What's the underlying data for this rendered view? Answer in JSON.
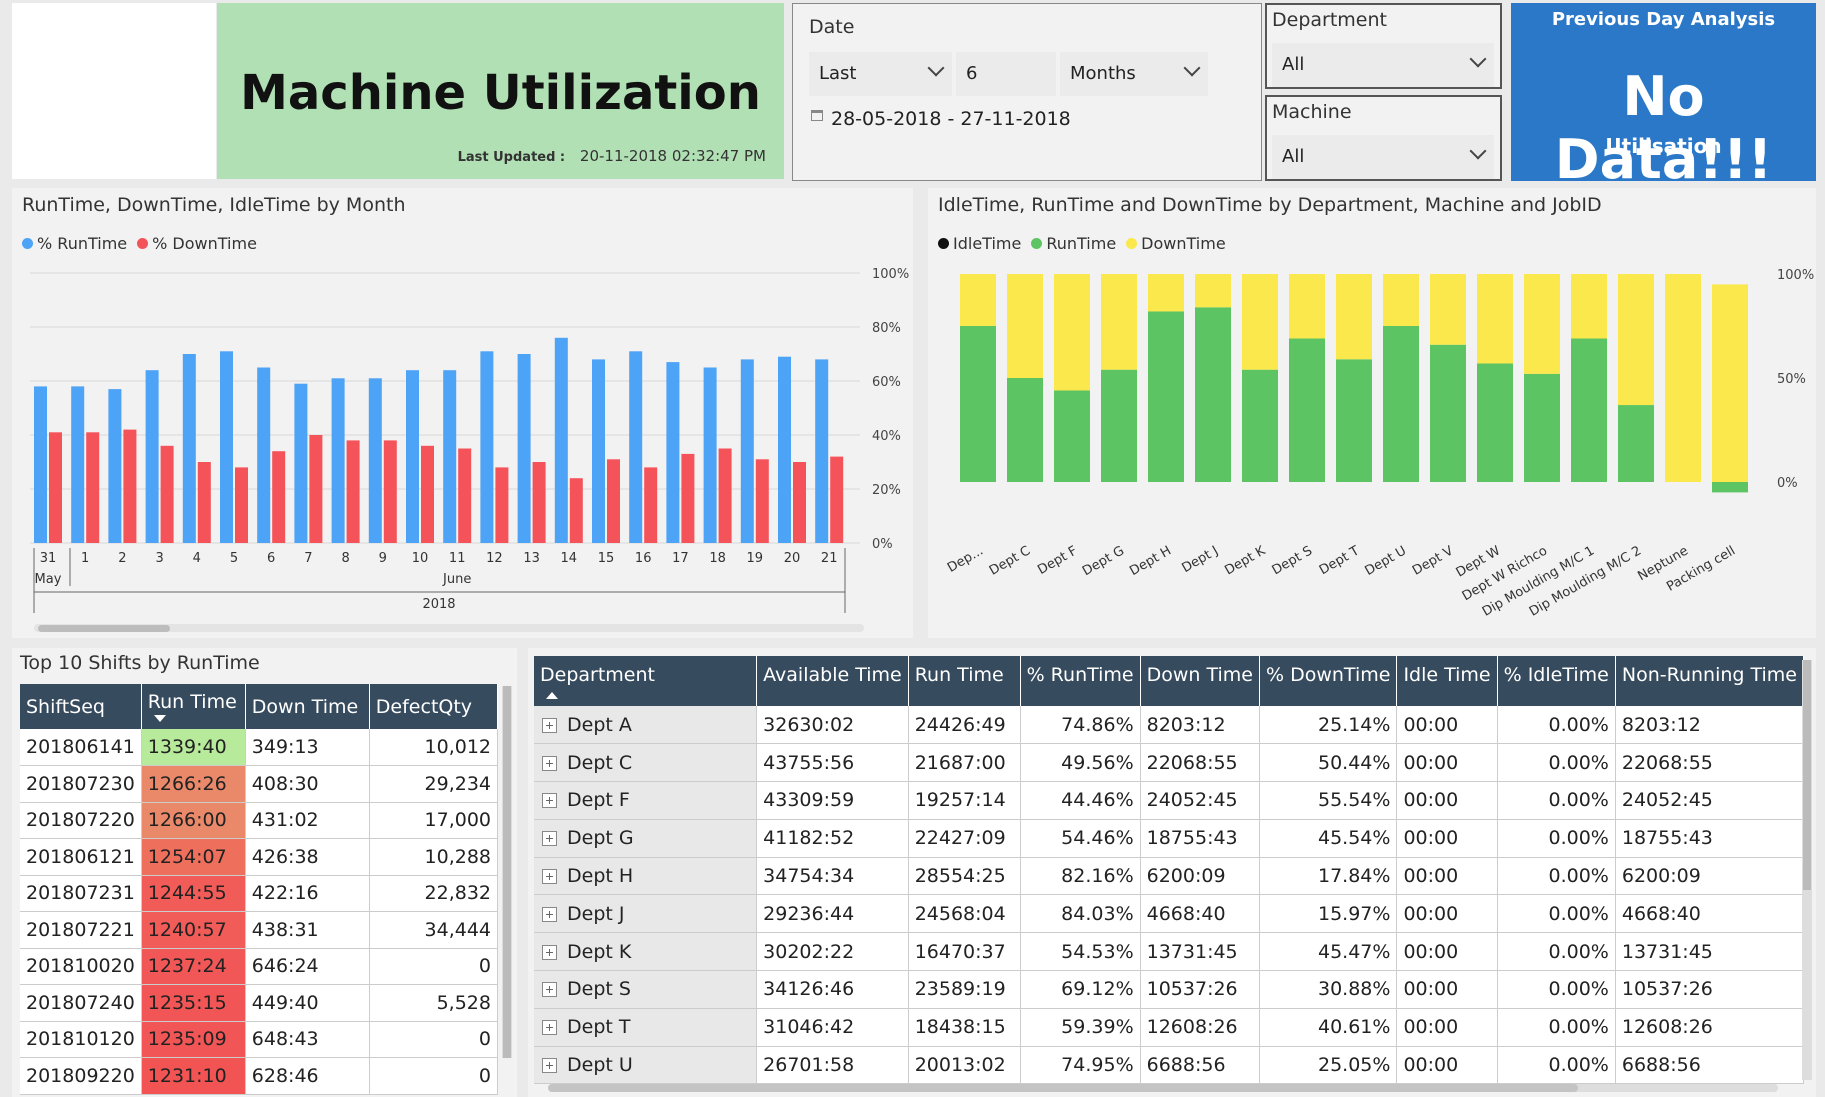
{
  "header": {
    "title": "Machine Utilization",
    "last_updated_label": "Last Updated :",
    "last_updated_value": "20-11-2018 02:32:47 PM"
  },
  "date_slicer": {
    "title": "Date",
    "mode": "Last",
    "count": "6",
    "unit": "Months",
    "range": "28-05-2018 - 27-11-2018"
  },
  "department_slicer": {
    "title": "Department",
    "value": "All"
  },
  "machine_slicer": {
    "title": "Machine",
    "value": "All"
  },
  "previous_day": {
    "title": "Previous Day Analysis",
    "value": "No Data!!!",
    "subtitle": "Utilisation"
  },
  "colors": {
    "runtime_blue": "#4da3f5",
    "downtime_red": "#f5535a",
    "runtime_green": "#5cc463",
    "downtime_yellow": "#fae84c",
    "idle_black": "#111111",
    "header_navy": "#374b5e",
    "accent_blue": "#2a78c7"
  },
  "chart_data": [
    {
      "type": "bar",
      "title": "RunTime, DownTime, IdleTime by Month",
      "categories": [
        "31",
        "1",
        "2",
        "3",
        "4",
        "5",
        "6",
        "7",
        "8",
        "9",
        "10",
        "11",
        "12",
        "13",
        "14",
        "15",
        "16",
        "17",
        "18",
        "19",
        "20",
        "21"
      ],
      "group_labels": [
        {
          "label": "May",
          "from": 0,
          "to": 0
        },
        {
          "label": "June",
          "from": 1,
          "to": 21
        }
      ],
      "year_label": "2018",
      "series": [
        {
          "name": "% RunTime",
          "color": "#4da3f5",
          "values": [
            58,
            58,
            57,
            64,
            70,
            71,
            65,
            59,
            61,
            61,
            64,
            64,
            71,
            70,
            76,
            68,
            71,
            67,
            65,
            68,
            69,
            68
          ]
        },
        {
          "name": "% DownTime",
          "color": "#f5535a",
          "values": [
            41,
            41,
            42,
            36,
            30,
            28,
            34,
            40,
            38,
            38,
            36,
            35,
            28,
            30,
            24,
            31,
            28,
            33,
            35,
            31,
            30,
            32
          ]
        }
      ],
      "y_ticks": [
        "0%",
        "20%",
        "40%",
        "60%",
        "80%",
        "100%"
      ],
      "ylim": [
        0,
        100
      ]
    },
    {
      "type": "bar",
      "stacked": true,
      "title": "IdleTime, RunTime and DownTime by Department, Machine and JobID",
      "categories": [
        "Dep...",
        "Dept C",
        "Dept F",
        "Dept G",
        "Dept H",
        "Dept J",
        "Dept K",
        "Dept S",
        "Dept T",
        "Dept U",
        "Dept V",
        "Dept W",
        "Dept W Richco",
        "Dip Moulding M/C 1",
        "Dip Moulding M/C 2",
        "Neptune",
        "Packing cell"
      ],
      "series": [
        {
          "name": "IdleTime",
          "color": "#111111",
          "values": [
            0,
            0,
            0,
            0,
            0,
            0,
            0,
            0,
            0,
            0,
            0,
            0,
            0,
            0,
            0,
            0,
            0
          ]
        },
        {
          "name": "RunTime",
          "color": "#5cc463",
          "values": [
            75,
            50,
            44,
            54,
            82,
            84,
            54,
            69,
            59,
            75,
            66,
            57,
            52,
            69,
            37,
            0,
            -5
          ]
        },
        {
          "name": "DownTime",
          "color": "#fae84c",
          "values": [
            25,
            50,
            56,
            46,
            18,
            16,
            46,
            31,
            41,
            25,
            34,
            43,
            48,
            31,
            63,
            100,
            95
          ]
        }
      ],
      "y_ticks": [
        "0%",
        "50%",
        "100%"
      ],
      "ylim": [
        -5,
        100
      ]
    }
  ],
  "top10": {
    "title": "Top 10 Shifts by RunTime",
    "columns": [
      "ShiftSeq",
      "Run Time",
      "Down Time",
      "DefectQty"
    ],
    "rows": [
      [
        "201806141",
        "1339:40",
        "349:13",
        "10,012"
      ],
      [
        "201807230",
        "1266:26",
        "408:30",
        "29,234"
      ],
      [
        "201807220",
        "1266:00",
        "431:02",
        "17,000"
      ],
      [
        "201806121",
        "1254:07",
        "426:38",
        "10,288"
      ],
      [
        "201807231",
        "1244:55",
        "422:16",
        "22,832"
      ],
      [
        "201807221",
        "1240:57",
        "438:31",
        "34,444"
      ],
      [
        "201810020",
        "1237:24",
        "646:24",
        "0"
      ],
      [
        "201807240",
        "1235:15",
        "449:40",
        "5,528"
      ],
      [
        "201810120",
        "1235:09",
        "648:43",
        "0"
      ],
      [
        "201809220",
        "1231:10",
        "628:46",
        "0"
      ]
    ],
    "runtime_colors": [
      "#b7ea9b",
      "#e9896a",
      "#e9896a",
      "#ef6f5d",
      "#f15b58",
      "#f15b58",
      "#f15757",
      "#f25555",
      "#f25555",
      "#f25454"
    ]
  },
  "dept_table": {
    "columns": [
      "Department",
      "Available Time",
      "Run Time",
      "% RunTime",
      "Down Time",
      "% DownTime",
      "Idle Time",
      "% IdleTime",
      "Non-Running Time"
    ],
    "rows": [
      [
        "Dept A",
        "32630:02",
        "24426:49",
        "74.86%",
        "8203:12",
        "25.14%",
        "00:00",
        "0.00%",
        "8203:12"
      ],
      [
        "Dept C",
        "43755:56",
        "21687:00",
        "49.56%",
        "22068:55",
        "50.44%",
        "00:00",
        "0.00%",
        "22068:55"
      ],
      [
        "Dept F",
        "43309:59",
        "19257:14",
        "44.46%",
        "24052:45",
        "55.54%",
        "00:00",
        "0.00%",
        "24052:45"
      ],
      [
        "Dept G",
        "41182:52",
        "22427:09",
        "54.46%",
        "18755:43",
        "45.54%",
        "00:00",
        "0.00%",
        "18755:43"
      ],
      [
        "Dept H",
        "34754:34",
        "28554:25",
        "82.16%",
        "6200:09",
        "17.84%",
        "00:00",
        "0.00%",
        "6200:09"
      ],
      [
        "Dept J",
        "29236:44",
        "24568:04",
        "84.03%",
        "4668:40",
        "15.97%",
        "00:00",
        "0.00%",
        "4668:40"
      ],
      [
        "Dept K",
        "30202:22",
        "16470:37",
        "54.53%",
        "13731:45",
        "45.47%",
        "00:00",
        "0.00%",
        "13731:45"
      ],
      [
        "Dept S",
        "34126:46",
        "23589:19",
        "69.12%",
        "10537:26",
        "30.88%",
        "00:00",
        "0.00%",
        "10537:26"
      ],
      [
        "Dept T",
        "31046:42",
        "18438:15",
        "59.39%",
        "12608:26",
        "40.61%",
        "00:00",
        "0.00%",
        "12608:26"
      ],
      [
        "Dept U",
        "26701:58",
        "20013:02",
        "74.95%",
        "6688:56",
        "25.05%",
        "00:00",
        "0.00%",
        "6688:56"
      ]
    ]
  }
}
